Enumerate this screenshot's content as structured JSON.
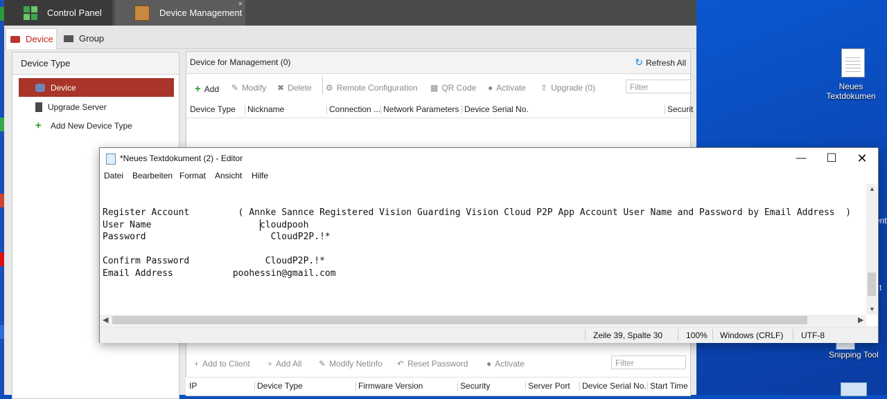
{
  "app": {
    "top_tabs": [
      {
        "label": "Control Panel",
        "icon": "control-panel-icon"
      },
      {
        "label": "Device Management",
        "icon": "device-management-icon",
        "close": "×"
      }
    ],
    "sub_tabs": [
      {
        "label": "Device",
        "icon": "device-icon",
        "active": true
      },
      {
        "label": "Group",
        "icon": "folder-icon"
      }
    ],
    "left_panel": {
      "header": "Device Type",
      "items": [
        {
          "label": "Device",
          "icon": "device-icon",
          "selected": true
        },
        {
          "label": "Upgrade Server",
          "icon": "server-icon"
        },
        {
          "label": "Add New Device Type",
          "icon": "plus-icon"
        }
      ]
    },
    "device_panel": {
      "title": "Device for Management (0)",
      "refresh": "Refresh All",
      "toolbar": [
        "Add",
        "Modify",
        "Delete",
        "Remote Configuration",
        "QR Code",
        "Activate",
        "Upgrade (0)"
      ],
      "filter_placeholder": "Filter",
      "columns": [
        "Device Type",
        "Nickname",
        "Connection ...",
        "Network Parameters",
        "Device Serial No.",
        "Securit"
      ]
    },
    "online_panel": {
      "toolbar": [
        "Add to Client",
        "Add All",
        "Modify Netinfo",
        "Reset Password",
        "Activate"
      ],
      "filter_placeholder": "Filter",
      "columns": [
        "IP",
        "Device Type",
        "Firmware Version",
        "Security",
        "Server Port",
        "Device Serial No.",
        "Start Time"
      ]
    }
  },
  "notepad": {
    "title": "*Neues Textdokument (2) - Editor",
    "menu": [
      "Datei",
      "Bearbeiten",
      "Format",
      "Ansicht",
      "Hilfe"
    ],
    "lines": [
      "Register Account         ( Annke Sannce Registered Vision Guarding Vision Cloud P2P App Account User Name and Password by Email Address  )",
      "User Name                    cloudpooh",
      "Password                       CloudP2P.!*",
      "",
      "Confirm Password              CloudP2P.!*",
      "Email Address           poohessin@gmail.com"
    ],
    "status": {
      "position": "Zeile 39, Spalte 30",
      "zoom": "100%",
      "line_ending": "Windows (CRLF)",
      "encoding": "UTF-8"
    }
  },
  "desktop": {
    "icons": [
      {
        "label": "Neues Textdokumen",
        "icon": "text-document-icon"
      },
      {
        "label": "Snipping Tool",
        "icon": "snipping-tool-icon"
      },
      {
        "label": "",
        "icon": "recycle-bin-icon"
      }
    ],
    "edge_fragments": [
      "ent",
      "xt"
    ]
  }
}
